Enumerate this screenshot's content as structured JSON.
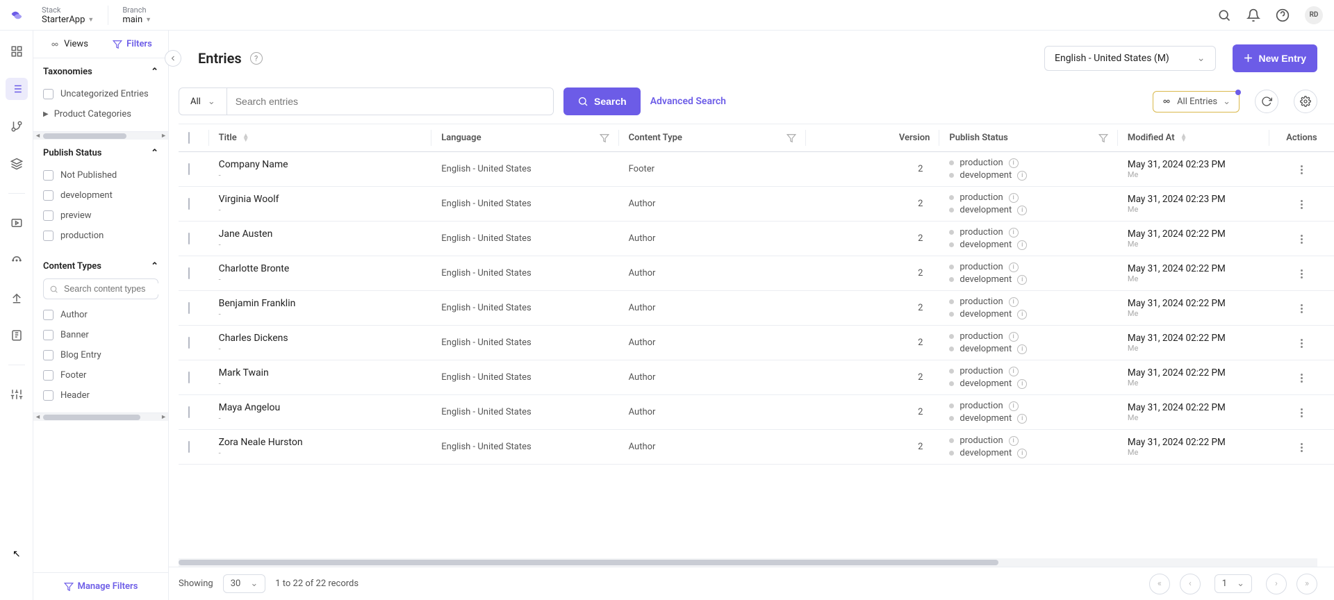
{
  "header": {
    "stack_label": "Stack",
    "stack_value": "StarterApp",
    "branch_label": "Branch",
    "branch_value": "main",
    "avatar": "RD"
  },
  "sidebar_filters": {
    "views_label": "Views",
    "filters_label": "Filters",
    "taxonomies": {
      "title": "Taxonomies",
      "uncategorized": "Uncategorized Entries",
      "product_categories": "Product Categories"
    },
    "publish_status": {
      "title": "Publish Status",
      "items": [
        "Not Published",
        "development",
        "preview",
        "production"
      ]
    },
    "content_types": {
      "title": "Content Types",
      "search_placeholder": "Search content types",
      "items": [
        "Author",
        "Banner",
        "Blog Entry",
        "Footer",
        "Header"
      ]
    },
    "manage_filters": "Manage Filters"
  },
  "page": {
    "title": "Entries",
    "locale": "English - United States (M)",
    "new_entry": "New Entry"
  },
  "search": {
    "scope": "All",
    "placeholder": "Search entries",
    "button": "Search",
    "advanced": "Advanced Search",
    "all_entries": "All Entries"
  },
  "columns": {
    "title": "Title",
    "language": "Language",
    "content_type": "Content Type",
    "version": "Version",
    "publish_status": "Publish Status",
    "modified_at": "Modified At",
    "actions": "Actions"
  },
  "publish_labels": {
    "production": "production",
    "development": "development"
  },
  "rows": [
    {
      "title": "Company Name",
      "sub": "-",
      "language": "English - United States",
      "content_type": "Footer",
      "version": 2,
      "modified": "May 31, 2024 02:23 PM",
      "by": "Me"
    },
    {
      "title": "Virginia Woolf",
      "sub": "-",
      "language": "English - United States",
      "content_type": "Author",
      "version": 2,
      "modified": "May 31, 2024 02:23 PM",
      "by": "Me"
    },
    {
      "title": "Jane Austen",
      "sub": "-",
      "language": "English - United States",
      "content_type": "Author",
      "version": 2,
      "modified": "May 31, 2024 02:22 PM",
      "by": "Me"
    },
    {
      "title": "Charlotte Bronte",
      "sub": "-",
      "language": "English - United States",
      "content_type": "Author",
      "version": 2,
      "modified": "May 31, 2024 02:22 PM",
      "by": "Me"
    },
    {
      "title": "Benjamin Franklin",
      "sub": "-",
      "language": "English - United States",
      "content_type": "Author",
      "version": 2,
      "modified": "May 31, 2024 02:22 PM",
      "by": "Me"
    },
    {
      "title": "Charles Dickens",
      "sub": "-",
      "language": "English - United States",
      "content_type": "Author",
      "version": 2,
      "modified": "May 31, 2024 02:22 PM",
      "by": "Me"
    },
    {
      "title": "Mark Twain",
      "sub": "-",
      "language": "English - United States",
      "content_type": "Author",
      "version": 2,
      "modified": "May 31, 2024 02:22 PM",
      "by": "Me"
    },
    {
      "title": "Maya Angelou",
      "sub": "-",
      "language": "English - United States",
      "content_type": "Author",
      "version": 2,
      "modified": "May 31, 2024 02:22 PM",
      "by": "Me"
    },
    {
      "title": "Zora Neale Hurston",
      "sub": "-",
      "language": "English - United States",
      "content_type": "Author",
      "version": 2,
      "modified": "May 31, 2024 02:22 PM",
      "by": "Me"
    }
  ],
  "footer": {
    "showing": "Showing",
    "page_size": "30",
    "range": "1 to 22 of 22 records",
    "page": "1"
  }
}
